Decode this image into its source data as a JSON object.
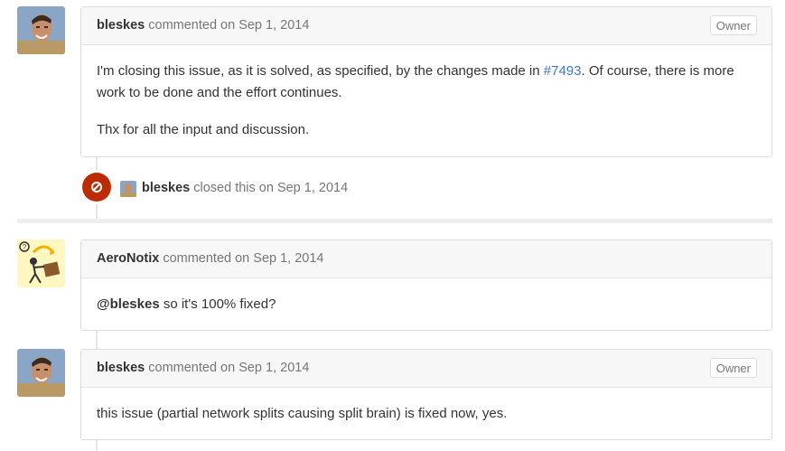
{
  "comments": [
    {
      "author": "bleskes",
      "meta": "commented on Sep 1, 2014",
      "badge": "Owner",
      "p1_before": "I'm closing this issue, as it is solved, as specified, by the changes made in ",
      "p1_link": "#7493",
      "p1_after": ". Of course, there is more work to be done and the effort continues.",
      "p2": "Thx for all the input and discussion."
    },
    {
      "author": "AeroNotix",
      "meta": "commented on Sep 1, 2014",
      "mention": "@bleskes",
      "text": " so it's 100% fixed?"
    },
    {
      "author": "bleskes",
      "meta": "commented on Sep 1, 2014",
      "badge": "Owner",
      "text": "this issue (partial network splits causing split brain) is fixed now, yes."
    }
  ],
  "event": {
    "author": "bleskes",
    "text": "closed this on Sep 1, 2014",
    "icon": "closed-icon",
    "color": "#bd2c00"
  }
}
